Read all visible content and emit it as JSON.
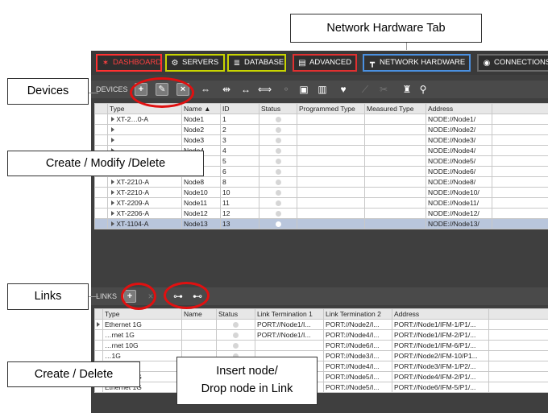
{
  "nav": {
    "tabs": [
      {
        "label": "DASHBOARD",
        "icon": "dashboard-icon",
        "color": "#ff3030",
        "text": "#ff4040"
      },
      {
        "label": "SERVERS",
        "icon": "gear-icon",
        "color": "#c8d400",
        "text": "#ffffff"
      },
      {
        "label": "DATABASE",
        "icon": "database-icon",
        "color": "#c8d400",
        "text": "#ffffff"
      },
      {
        "label": "ADVANCED",
        "icon": "document-icon",
        "color": "#e03030",
        "text": "#ffffff"
      },
      {
        "label": "NETWORK HARDWARE",
        "icon": "network-icon",
        "color": "#4a90e0",
        "text": "#ffffff"
      },
      {
        "label": "CONNECTIONS",
        "icon": "connections-icon",
        "color": "#7a7a7a",
        "text": "#ffffff"
      }
    ]
  },
  "devices": {
    "panel_label": "DEVICES",
    "columns": [
      "Type",
      "Name",
      "ID",
      "Status",
      "Programmed Type",
      "Measured Type",
      "Address"
    ],
    "rows": [
      {
        "type": "XT-2…0-A",
        "name": "Node1",
        "id": "1",
        "address": "NODE://Node1/"
      },
      {
        "type": "",
        "name": "Node2",
        "id": "2",
        "address": "NODE://Node2/"
      },
      {
        "type": "",
        "name": "Node3",
        "id": "3",
        "address": "NODE://Node3/"
      },
      {
        "type": "",
        "name": "Node4",
        "id": "4",
        "address": "NODE://Node4/"
      },
      {
        "type": "XT-2210-A",
        "name": "Node5",
        "id": "5",
        "address": "NODE://Node5/"
      },
      {
        "type": "XT-2209-A",
        "name": "Node6",
        "id": "6",
        "address": "NODE://Node6/"
      },
      {
        "type": "XT-2210-A",
        "name": "Node8",
        "id": "8",
        "address": "NODE://Node8/"
      },
      {
        "type": "XT-2210-A",
        "name": "Node10",
        "id": "10",
        "address": "NODE://Node10/"
      },
      {
        "type": "XT-2209-A",
        "name": "Node11",
        "id": "11",
        "address": "NODE://Node11/"
      },
      {
        "type": "XT-2206-A",
        "name": "Node12",
        "id": "12",
        "address": "NODE://Node12/"
      },
      {
        "type": "XT-1104-A",
        "name": "Node13",
        "id": "13",
        "address": "NODE://Node13/",
        "selected": true
      }
    ]
  },
  "links": {
    "panel_label": "LINKS",
    "columns": [
      "Type",
      "Name",
      "Status",
      "Link Termination 1",
      "Link Termination 2",
      "Address"
    ],
    "rows": [
      {
        "type": "Ethernet 1G",
        "t1": "PORT://Node1/I...",
        "t2": "PORT://Node2/I...",
        "address": "PORT://Node1/IFM-1/P1/..."
      },
      {
        "type": "…rnet 1G",
        "t1": "PORT://Node1/I...",
        "t2": "PORT://Node4/I...",
        "address": "PORT://Node1/IFM-2/P1/..."
      },
      {
        "type": "…rnet 10G",
        "t1": "",
        "t2": "PORT://Node6/I...",
        "address": "PORT://Node1/IFM-6/P1/..."
      },
      {
        "type": "…1G",
        "t1": "",
        "t2": "PORT://Node3/I...",
        "address": "PORT://Node2/IFM-10/P1..."
      },
      {
        "type": "…1G",
        "t1": "",
        "t2": "PORT://Node4/I...",
        "address": "PORT://Node3/IFM-1/P2/..."
      },
      {
        "type": "Ethernet 1G",
        "t1": "",
        "t2": "PORT://Node5/I...",
        "address": "PORT://Node4/IFM-2/P1/..."
      },
      {
        "type": "Ethernet 1G",
        "t1": "",
        "t2": "PORT://Node5/I...",
        "address": "PORT://Node6/IFM-5/P1/..."
      }
    ]
  },
  "callouts": {
    "network_hardware_tab": "Network Hardware Tab",
    "devices": "Devices",
    "create_modify_delete": "Create / Modify /Delete",
    "links": "Links",
    "create_delete": "Create / Delete",
    "insert_node": "Insert node/",
    "drop_node": "Drop node in Link"
  }
}
